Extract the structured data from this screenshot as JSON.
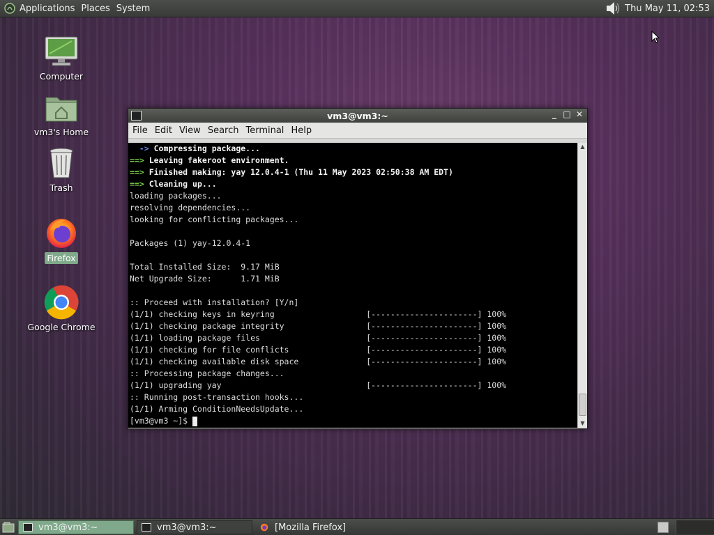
{
  "top_panel": {
    "menus": [
      "Applications",
      "Places",
      "System"
    ],
    "clock": "Thu May 11, 02:53",
    "icons": {
      "menu_logo": "gnome-foot-icon",
      "volume": "speaker-icon"
    }
  },
  "desktop": {
    "icons": [
      {
        "label": "Computer",
        "icon": "computer-icon"
      },
      {
        "label": "vm3's Home",
        "icon": "home-folder-icon"
      },
      {
        "label": "Trash",
        "icon": "trash-icon"
      },
      {
        "label": "Firefox",
        "icon": "firefox-icon",
        "selected": true
      },
      {
        "label": "Google Chrome",
        "icon": "chrome-icon"
      }
    ]
  },
  "terminal": {
    "title": "vm3@vm3:~",
    "controls": [
      "_",
      "□",
      "✕"
    ],
    "menu": [
      "File",
      "Edit",
      "View",
      "Search",
      "Terminal",
      "Help"
    ],
    "lines": [
      {
        "prefix": "  ->",
        "prefix_style": "arrow-b",
        "text": " Compressing package...",
        "bold": true
      },
      {
        "prefix": "==>",
        "prefix_style": "arrow-g",
        "text": " Leaving fakeroot environment.",
        "bold": true
      },
      {
        "prefix": "==>",
        "prefix_style": "arrow-g",
        "text": " Finished making: yay 12.0.4-1 (Thu 11 May 2023 02:50:38 AM EDT)",
        "bold": true
      },
      {
        "prefix": "==>",
        "prefix_style": "arrow-g",
        "text": " Cleaning up...",
        "bold": true
      },
      {
        "text": "loading packages..."
      },
      {
        "text": "resolving dependencies..."
      },
      {
        "text": "looking for conflicting packages..."
      },
      {
        "text": ""
      },
      {
        "text": "Packages (1) yay-12.0.4-1"
      },
      {
        "text": ""
      },
      {
        "text": "Total Installed Size:  9.17 MiB"
      },
      {
        "text": "Net Upgrade Size:      1.71 MiB"
      },
      {
        "text": ""
      },
      {
        "text": ":: Proceed with installation? [Y/n]"
      },
      {
        "text": "(1/1) checking keys in keyring                   [----------------------] 100%"
      },
      {
        "text": "(1/1) checking package integrity                 [----------------------] 100%"
      },
      {
        "text": "(1/1) loading package files                      [----------------------] 100%"
      },
      {
        "text": "(1/1) checking for file conflicts                [----------------------] 100%"
      },
      {
        "text": "(1/1) checking available disk space              [----------------------] 100%"
      },
      {
        "text": ":: Processing package changes..."
      },
      {
        "text": "(1/1) upgrading yay                              [----------------------] 100%"
      },
      {
        "text": ":: Running post-transaction hooks..."
      },
      {
        "text": "(1/1) Arming ConditionNeedsUpdate..."
      }
    ],
    "prompt": "[vm3@vm3 ~]$ "
  },
  "taskbar": {
    "tasks": [
      {
        "label": "vm3@vm3:~",
        "active": true,
        "icon": "terminal-icon"
      },
      {
        "label": "vm3@vm3:~",
        "active": false,
        "icon": "terminal-icon"
      },
      {
        "label": "[Mozilla Firefox]",
        "active": false,
        "icon": "firefox-icon"
      }
    ]
  }
}
